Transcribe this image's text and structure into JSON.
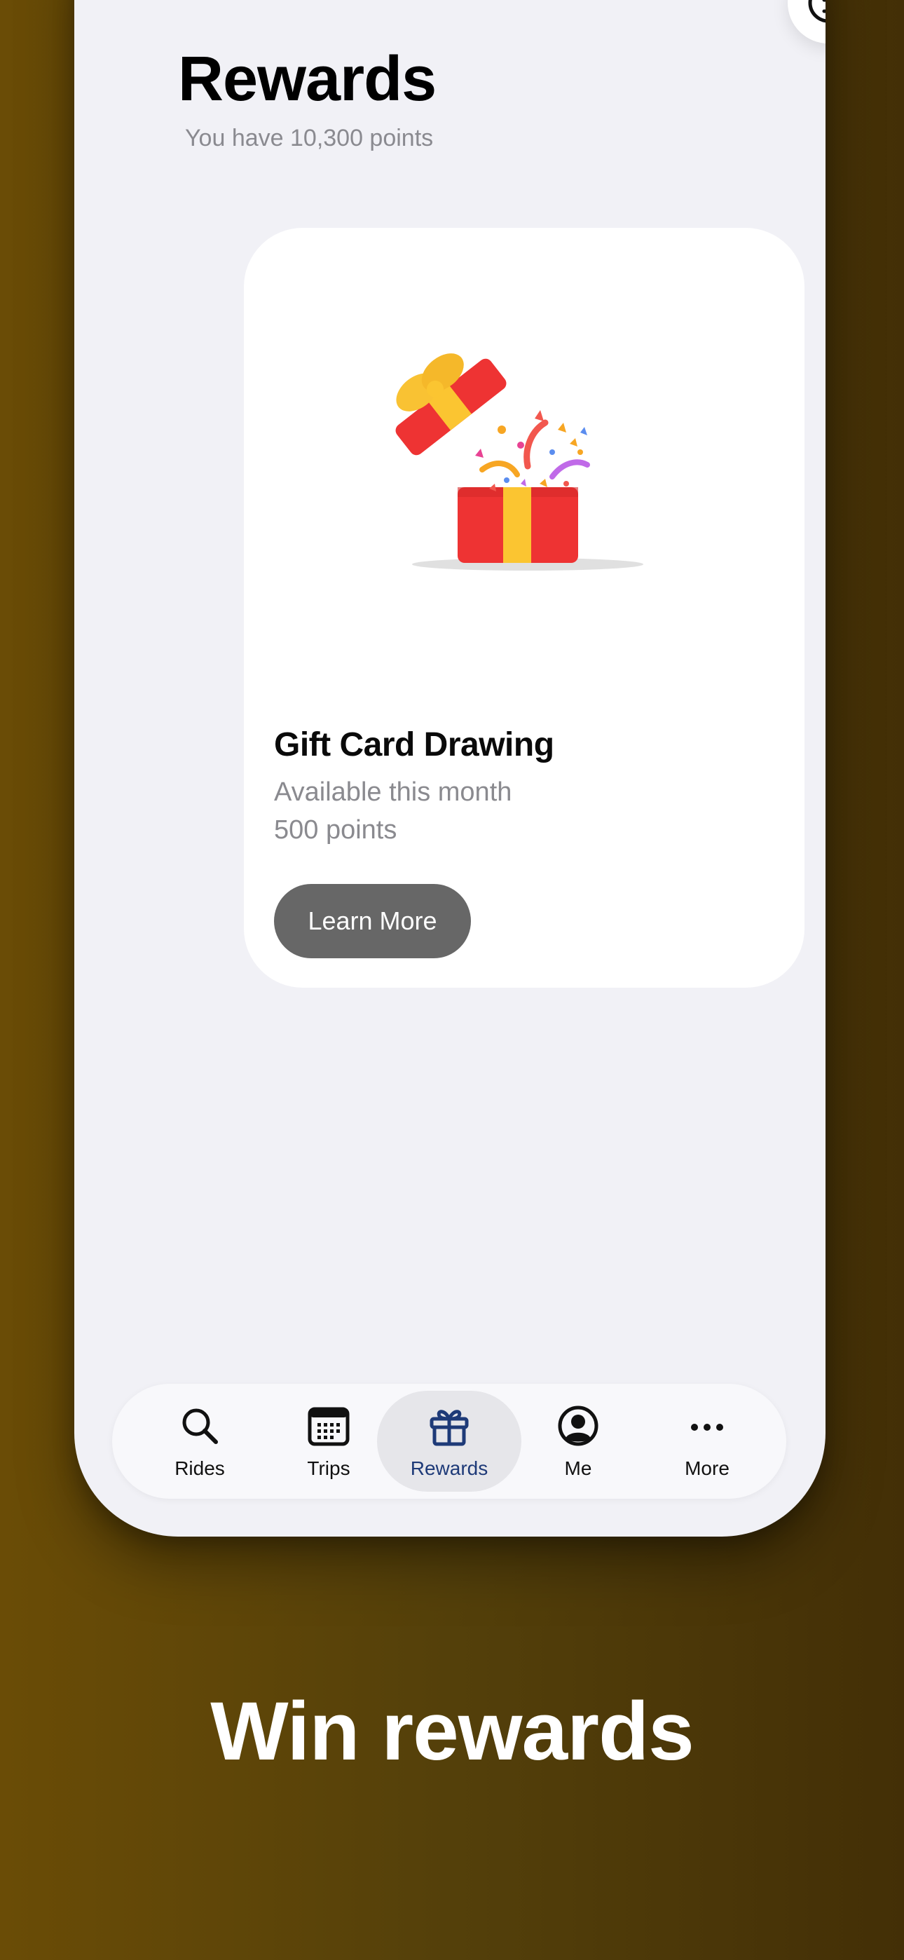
{
  "screen": {
    "title": "Rewards",
    "points_text": "You have 10,300 points",
    "info_icon": "info-icon"
  },
  "card": {
    "image_icon": "gift-box-icon",
    "title": "Gift Card Drawing",
    "availability": "Available this month",
    "cost": "500 points",
    "button_label": "Learn More"
  },
  "tabbar": {
    "active_tab": "Rewards",
    "items": [
      {
        "label": "Rides",
        "icon": "search-icon"
      },
      {
        "label": "Trips",
        "icon": "calendar-icon"
      },
      {
        "label": "Rewards",
        "icon": "gift-icon"
      },
      {
        "label": "Me",
        "icon": "account-icon"
      },
      {
        "label": "More",
        "icon": "more-icon"
      }
    ]
  },
  "promo": {
    "headline": "Win rewards"
  },
  "colors": {
    "background": "#5a4208",
    "screen_background": "#f1f1f6",
    "active_tab_text": "#1e3a78",
    "button_background": "#676767",
    "gift_red": "#ee3333",
    "gift_yellow": "#fbc531"
  }
}
